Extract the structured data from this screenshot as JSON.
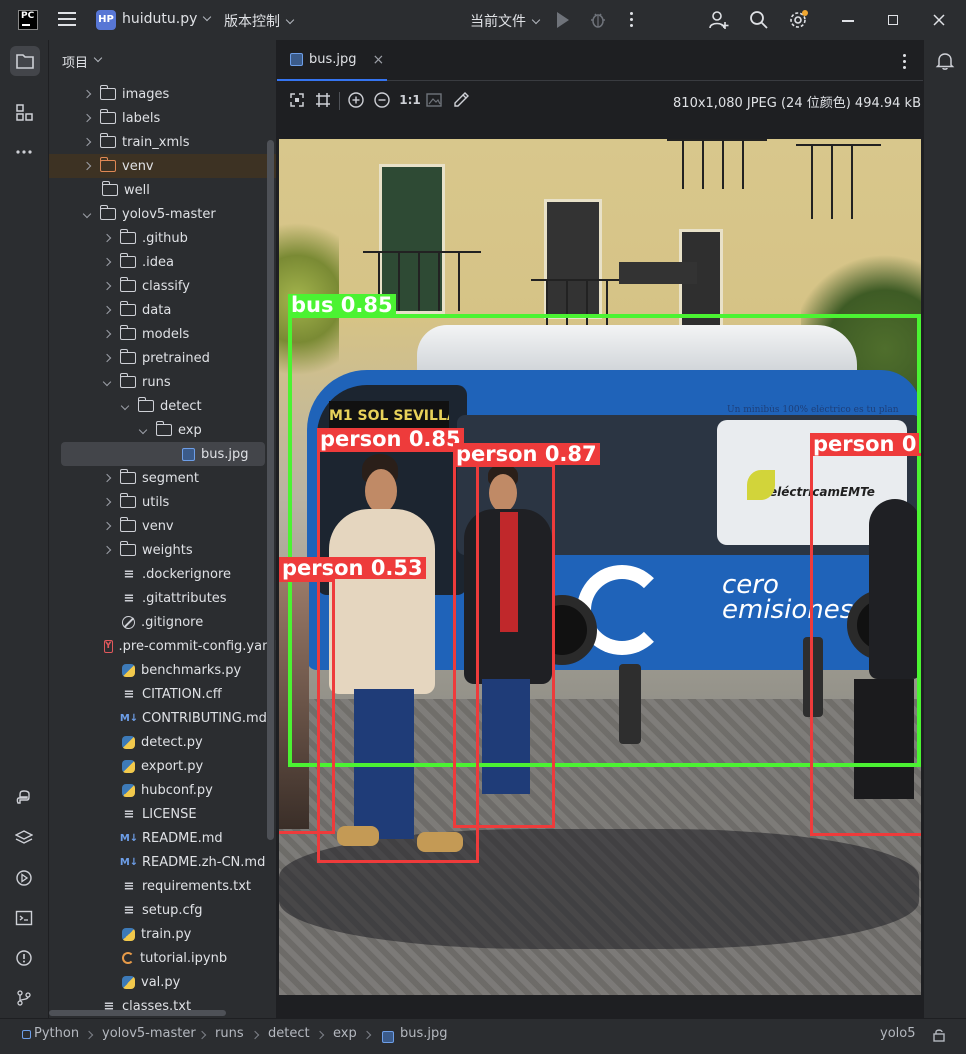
{
  "titlebar": {
    "logo_text": "PC",
    "project_badge": "HP",
    "project_name": "huidutu.py",
    "vcs_label": "版本控制",
    "run_config": "当前文件"
  },
  "project_panel": {
    "title": "项目",
    "items": [
      {
        "label": "images",
        "icon": "folder",
        "depth": 1,
        "arrow": "closed"
      },
      {
        "label": "labels",
        "icon": "folder",
        "depth": 1,
        "arrow": "closed"
      },
      {
        "label": "train_xmls",
        "icon": "folder",
        "depth": 1,
        "arrow": "closed"
      },
      {
        "label": "venv",
        "icon": "folder-orange",
        "depth": 1,
        "arrow": "closed",
        "highlight": "venv"
      },
      {
        "label": "well",
        "icon": "folder",
        "depth": 1,
        "arrow": "none"
      },
      {
        "label": "yolov5-master",
        "icon": "folder",
        "depth": 1,
        "arrow": "open"
      },
      {
        "label": ".github",
        "icon": "folder",
        "depth": 2,
        "arrow": "closed"
      },
      {
        "label": ".idea",
        "icon": "folder",
        "depth": 2,
        "arrow": "closed"
      },
      {
        "label": "classify",
        "icon": "folder",
        "depth": 2,
        "arrow": "closed"
      },
      {
        "label": "data",
        "icon": "folder",
        "depth": 2,
        "arrow": "closed"
      },
      {
        "label": "models",
        "icon": "folder",
        "depth": 2,
        "arrow": "closed"
      },
      {
        "label": "pretrained",
        "icon": "folder",
        "depth": 2,
        "arrow": "closed"
      },
      {
        "label": "runs",
        "icon": "folder",
        "depth": 2,
        "arrow": "open"
      },
      {
        "label": "detect",
        "icon": "folder",
        "depth": 3,
        "arrow": "open"
      },
      {
        "label": "exp",
        "icon": "folder",
        "depth": 4,
        "arrow": "open"
      },
      {
        "label": "bus.jpg",
        "icon": "image",
        "depth": 5,
        "arrow": "none",
        "selected": true
      },
      {
        "label": "segment",
        "icon": "folder",
        "depth": 2,
        "arrow": "closed"
      },
      {
        "label": "utils",
        "icon": "folder",
        "depth": 2,
        "arrow": "closed"
      },
      {
        "label": "venv",
        "icon": "folder",
        "depth": 2,
        "arrow": "closed"
      },
      {
        "label": "weights",
        "icon": "folder",
        "depth": 2,
        "arrow": "closed"
      },
      {
        "label": ".dockerignore",
        "icon": "text",
        "depth": 2,
        "arrow": "none"
      },
      {
        "label": ".gitattributes",
        "icon": "text",
        "depth": 2,
        "arrow": "none"
      },
      {
        "label": ".gitignore",
        "icon": "ban",
        "depth": 2,
        "arrow": "none"
      },
      {
        "label": ".pre-commit-config.yaml",
        "icon": "yaml",
        "depth": 2,
        "arrow": "none"
      },
      {
        "label": "benchmarks.py",
        "icon": "python",
        "depth": 2,
        "arrow": "none"
      },
      {
        "label": "CITATION.cff",
        "icon": "text",
        "depth": 2,
        "arrow": "none"
      },
      {
        "label": "CONTRIBUTING.md",
        "icon": "markdown",
        "depth": 2,
        "arrow": "none"
      },
      {
        "label": "detect.py",
        "icon": "python",
        "depth": 2,
        "arrow": "none"
      },
      {
        "label": "export.py",
        "icon": "python",
        "depth": 2,
        "arrow": "none"
      },
      {
        "label": "hubconf.py",
        "icon": "python",
        "depth": 2,
        "arrow": "none"
      },
      {
        "label": "LICENSE",
        "icon": "text",
        "depth": 2,
        "arrow": "none"
      },
      {
        "label": "README.md",
        "icon": "markdown",
        "depth": 2,
        "arrow": "none"
      },
      {
        "label": "README.zh-CN.md",
        "icon": "markdown",
        "depth": 2,
        "arrow": "none"
      },
      {
        "label": "requirements.txt",
        "icon": "text",
        "depth": 2,
        "arrow": "none"
      },
      {
        "label": "setup.cfg",
        "icon": "text",
        "depth": 2,
        "arrow": "none"
      },
      {
        "label": "train.py",
        "icon": "python",
        "depth": 2,
        "arrow": "none"
      },
      {
        "label": "tutorial.ipynb",
        "icon": "notebook",
        "depth": 2,
        "arrow": "none"
      },
      {
        "label": "val.py",
        "icon": "python",
        "depth": 2,
        "arrow": "none"
      },
      {
        "label": "classes.txt",
        "icon": "text",
        "depth": 1,
        "arrow": "none"
      }
    ]
  },
  "editor": {
    "tab_label": "bus.jpg",
    "image_info": "810x1,080 JPEG (24 位颜色) 494.94 kB",
    "zoom_label": "1:1",
    "detections": [
      {
        "label": "bus 0.85",
        "class": "bus",
        "color": "#4bf332"
      },
      {
        "label": "person 0.85",
        "class": "person",
        "color": "#ee3b3b"
      },
      {
        "label": "person 0.87",
        "class": "person",
        "color": "#ee3b3b"
      },
      {
        "label": "person 0.53",
        "class": "person",
        "color": "#ee3b3b"
      },
      {
        "label": "person 0",
        "class": "person",
        "color": "#ee3b3b"
      }
    ],
    "photo_text": {
      "bus_sign": "M1 SOL SEVILLA",
      "bus_slogan": "Un minibús 100% eléctrico es tu plan",
      "bus_brand": "eléctricamEMTe",
      "bus_emissions_1": "cero",
      "bus_emissions_2": "emisiones"
    }
  },
  "statusbar": {
    "breadcrumbs": [
      "Python",
      "yolov5-master",
      "runs",
      "detect",
      "exp",
      "bus.jpg"
    ],
    "interpreter": "yolo5"
  },
  "colors": {
    "accent": "#3574f0",
    "bus_box": "#4bf332",
    "person_box": "#ee3b3b",
    "panel_bg": "#2b2d30",
    "editor_bg": "#1e1f22"
  }
}
